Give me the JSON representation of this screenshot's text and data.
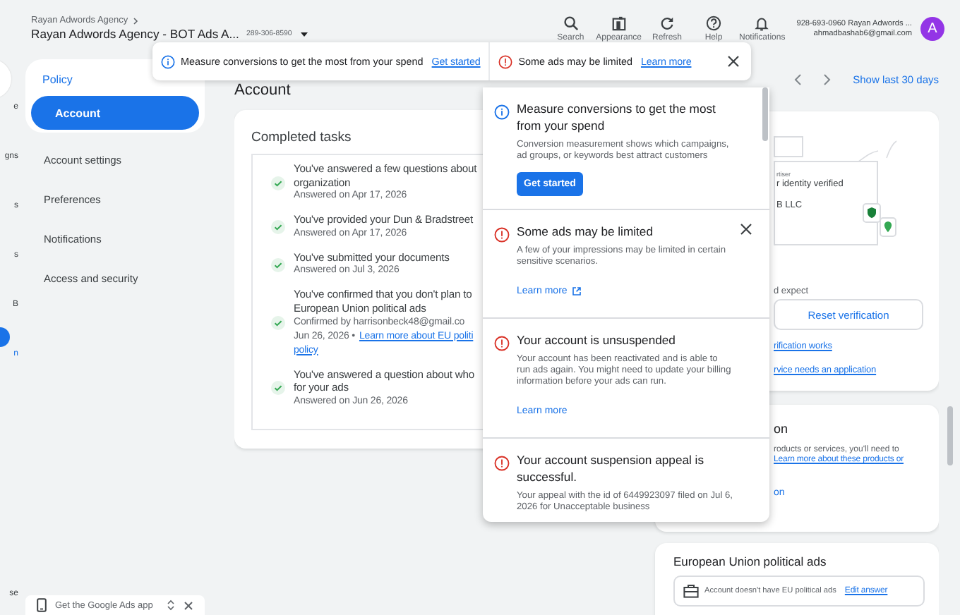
{
  "header": {
    "breadcrumb": "Rayan Adwords Agency",
    "account_name": "Rayan Adwords Agency - BOT Ads A...",
    "customer_id": "289-306-8590",
    "tools": [
      {
        "kind": "search",
        "label": "Search"
      },
      {
        "kind": "appearance",
        "label": "Appearance"
      },
      {
        "kind": "refresh",
        "label": "Refresh"
      },
      {
        "kind": "help",
        "label": "Help"
      },
      {
        "kind": "notifications",
        "label": "Notifications"
      }
    ],
    "user": {
      "line": "928-693-0960 Rayan Adwords ...",
      "email": "ahmadbashab6@gmail.com",
      "avatar": "A"
    }
  },
  "toast": {
    "items": [
      {
        "kind": "info",
        "text": "Measure conversions to get the most from your spend",
        "link": "Get started"
      },
      {
        "kind": "warning",
        "text": "Some ads may be limited",
        "link": "Learn more"
      }
    ]
  },
  "rail": {
    "items": [
      {
        "kind": "home",
        "label": "e",
        "selected": false
      },
      {
        "kind": "plain",
        "label": "gns",
        "selected": false
      },
      {
        "kind": "plain",
        "label": "s",
        "selected": false
      },
      {
        "kind": "plain",
        "label": "s",
        "selected": false
      },
      {
        "kind": "plain",
        "label": "B",
        "selected": false
      },
      {
        "kind": "plain",
        "label": "n",
        "selected": true
      }
    ],
    "footer": "se"
  },
  "policy_nav": {
    "heading": "Policy",
    "items": [
      {
        "label": "Account",
        "selected": true
      },
      {
        "label": "Account settings",
        "selected": false
      },
      {
        "label": "Preferences",
        "selected": false
      },
      {
        "label": "Notifications",
        "selected": false
      },
      {
        "label": "Access and security",
        "selected": false
      }
    ]
  },
  "app_banner": {
    "label": "Get the Google Ads app"
  },
  "page_title": "Account",
  "date_nav": {
    "range": "Show last 30 days"
  },
  "completed_tasks": {
    "title": "Completed tasks",
    "tasks": [
      {
        "title": "You've answered a few questions about\norganization",
        "date": "Answered on Apr 17, 2026"
      },
      {
        "title": "You've provided your Dun & Bradstreet",
        "date": "Answered on Apr 17, 2026"
      },
      {
        "title": "You've submitted your documents",
        "date": "Answered on Jul 3, 2026"
      },
      {
        "title": "You've confirmed that you don't plan to\nEuropean Union political ads",
        "detail": "Confirmed by harrisonbeck48@gmail.co",
        "date": "Jun 26, 2026 •",
        "links": [
          "Learn more about EU politi",
          "policy"
        ]
      },
      {
        "title": "You've answered a question about who\nfor your ads",
        "date": "Answered on Jun 26, 2026"
      }
    ]
  },
  "verification_card": {
    "illustration": {
      "label": "rtiser",
      "status": "r identity verified",
      "company": "B LLC"
    },
    "text": "d expect",
    "button": "Reset verification",
    "links": [
      "rification works",
      "rvice needs an application"
    ]
  },
  "products_card": {
    "title": "on",
    "text": "roducts or services, you'll need to",
    "links": [
      "Learn more about these products or",
      "on"
    ]
  },
  "eu_card": {
    "title": "European Union political ads",
    "status": "Account doesn't have EU political ads",
    "action": "Edit answer"
  },
  "notifications_panel": {
    "items": [
      {
        "kind": "info",
        "title": "Measure conversions to get the most from your spend",
        "body": "Conversion measurement shows which campaigns, ad groups, or keywords best attract customers",
        "action": {
          "kind": "button",
          "label": "Get started"
        },
        "dismissible": false
      },
      {
        "kind": "warning",
        "title": "Some ads may be limited",
        "body": "A few of your impressions may be limited in certain sensitive scenarios.",
        "action": {
          "kind": "external_link",
          "label": "Learn more"
        },
        "dismissible": true
      },
      {
        "kind": "warning",
        "title": "Your account is unsuspended",
        "body": "Your account has been reactivated and is able to run ads again. You might need to update your billing information before your ads can run.",
        "action": {
          "kind": "link",
          "label": "Learn more"
        },
        "dismissible": false
      },
      {
        "kind": "warning",
        "title": "Your account suspension appeal is successful.",
        "body": "Your appeal with the id of 6449923097 filed on Jul 6, 2026 for Unacceptable business",
        "dismissible": false
      }
    ]
  }
}
